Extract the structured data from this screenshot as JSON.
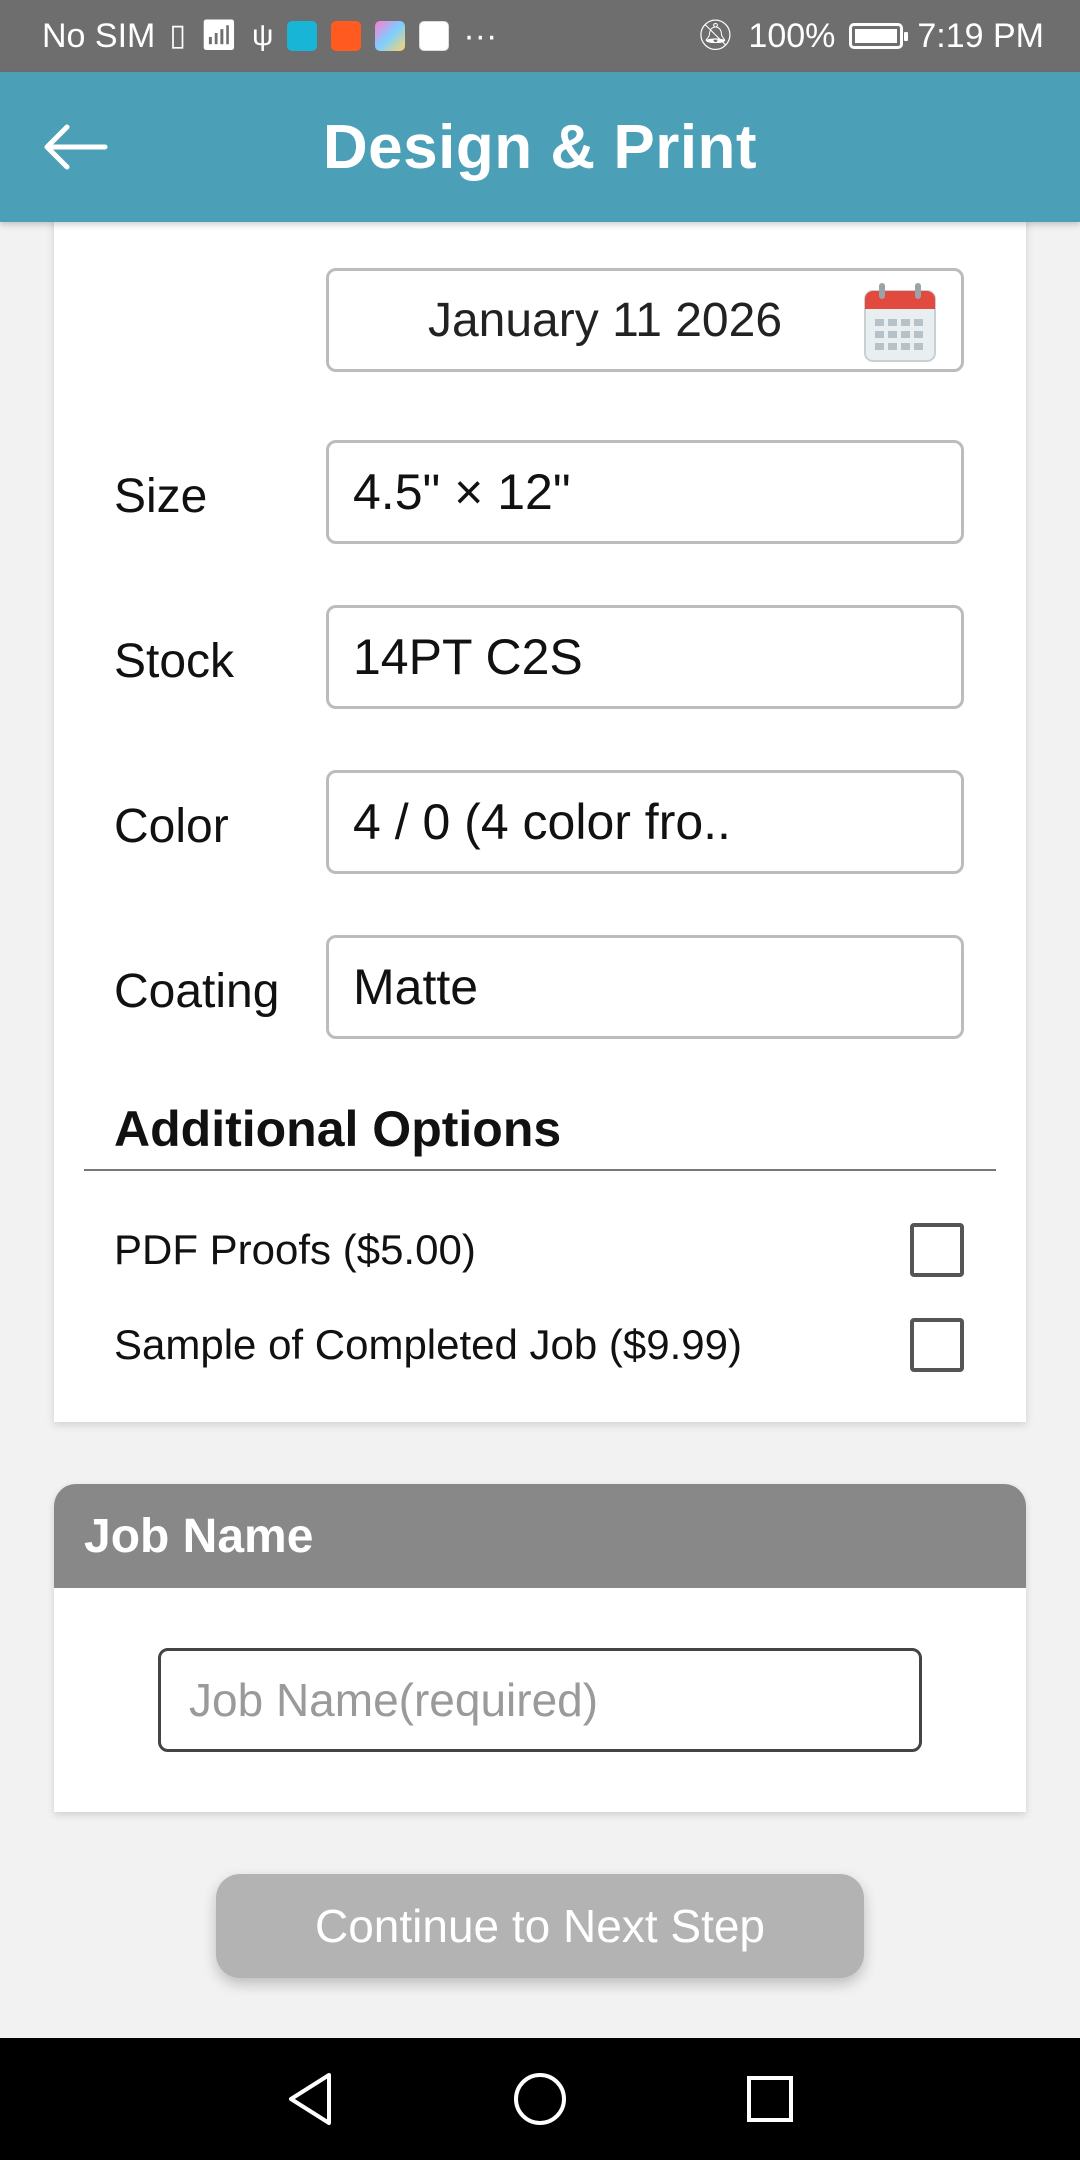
{
  "status_bar": {
    "carrier": "No SIM",
    "battery": "100%",
    "time": "7:19 PM",
    "more": "···"
  },
  "app_bar": {
    "title": "Design & Print"
  },
  "options": {
    "date_value": "January 11 2026",
    "size_label": "Size",
    "size_value": "4.5\" × 12\"",
    "stock_label": "Stock",
    "stock_value": "14PT C2S",
    "color_label": "Color",
    "color_value": "4 / 0 (4 color fro..",
    "coating_label": "Coating",
    "coating_value": "Matte"
  },
  "additional_options": {
    "title": "Additional Options",
    "items": [
      {
        "label": "PDF Proofs ($5.00)",
        "checked": false
      },
      {
        "label": "Sample of Completed Job ($9.99)",
        "checked": false
      }
    ]
  },
  "job_name": {
    "title": "Job Name",
    "placeholder": "Job Name(required)",
    "value": ""
  },
  "continue_button": {
    "label": "Continue to Next Step"
  },
  "colors": {
    "app_bar": "#4b9fb6",
    "job_header": "#888888",
    "continue_disabled": "#b3b3b3",
    "calendar_red": "#e2493f"
  }
}
